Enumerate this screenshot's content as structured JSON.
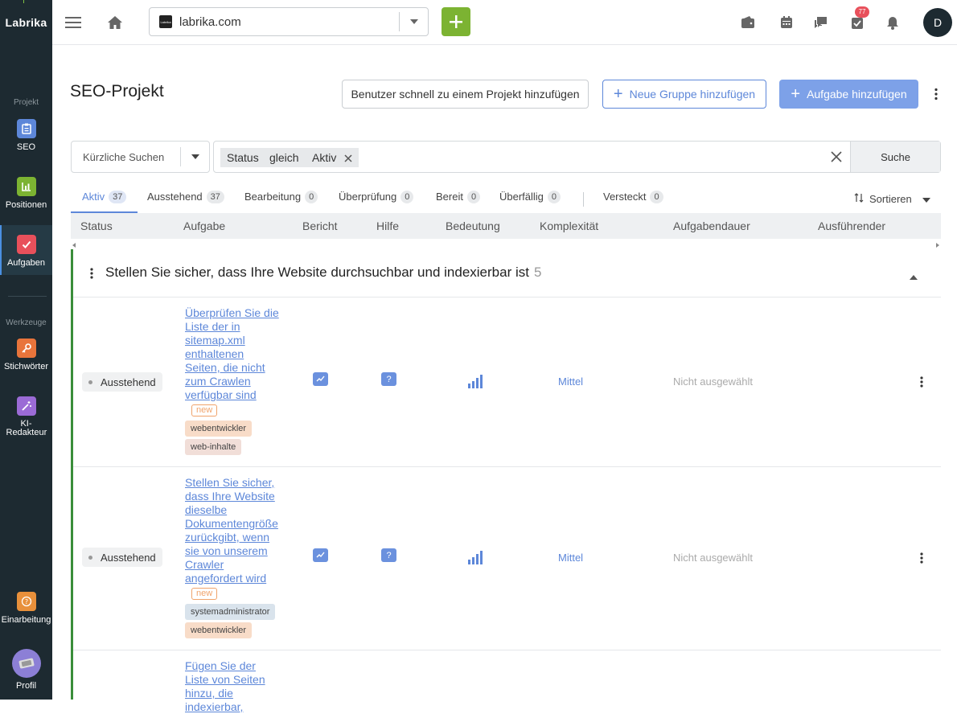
{
  "app": {
    "logo": "Labrika"
  },
  "sidebar": {
    "section_project": "Projekt",
    "section_tools": "Werkzeuge",
    "items": [
      {
        "label": "SEO",
        "color": "#5d87d9"
      },
      {
        "label": "Positionen",
        "color": "#7cb332"
      },
      {
        "label": "Aufgaben",
        "color": "#e8505b"
      },
      {
        "label": "Stichwörter",
        "color": "#e8743b"
      },
      {
        "label": "KI-Redakteur",
        "color": "#9b6bd6"
      },
      {
        "label": "Einarbeitung",
        "color": "#e8903b"
      },
      {
        "label": "Profil",
        "color": "#8c7fd6"
      }
    ]
  },
  "topbar": {
    "project_name": "labrika.com",
    "favicon_text": "Labrika",
    "tasks_badge": "77",
    "avatar_letter": "D"
  },
  "header": {
    "title": "SEO-Projekt",
    "btn_add_user": "Benutzer schnell zu einem Projekt hinzufügen",
    "btn_new_group": "Neue Gruppe hinzufügen",
    "btn_add_task": "Aufgabe hinzufügen"
  },
  "search": {
    "recent_label": "Kürzliche Suchen",
    "filter_field": "Status",
    "filter_op": "gleich",
    "filter_value": "Aktiv",
    "search_button": "Suche"
  },
  "tabs": [
    {
      "label": "Aktiv",
      "count": "37"
    },
    {
      "label": "Ausstehend",
      "count": "37"
    },
    {
      "label": "Bearbeitung",
      "count": "0"
    },
    {
      "label": "Überprüfung",
      "count": "0"
    },
    {
      "label": "Bereit",
      "count": "0"
    },
    {
      "label": "Überfällig",
      "count": "0"
    },
    {
      "label": "Versteckt",
      "count": "0"
    }
  ],
  "sort_label": "Sortieren",
  "columns": [
    "Status",
    "Aufgabe",
    "Bericht",
    "Hilfe",
    "Bedeutung",
    "Komplexität",
    "Aufgabendauer",
    "Ausführender"
  ],
  "group": {
    "title": "Stellen Sie sicher, dass Ihre Website durchsuchbar und indexierbar ist",
    "count": "5"
  },
  "rows": [
    {
      "status": "Ausstehend",
      "task": "Überprüfen Sie die Liste der in sitemap.xml enthaltenen Seiten, die nicht zum Crawlen verfügbar sind",
      "new_label": "new",
      "tags": [
        "webentwickler",
        "web-inhalte"
      ],
      "help": "?",
      "complexity": "Mittel",
      "duration": "Nicht ausgewählt"
    },
    {
      "status": "Ausstehend",
      "task": "Stellen Sie sicher, dass Ihre Website dieselbe Dokumentengröße zurückgibt, wenn sie von unserem Crawler angefordert wird",
      "new_label": "new",
      "tags": [
        "systemadministrator",
        "webentwickler"
      ],
      "help": "?",
      "complexity": "Mittel",
      "duration": "Nicht ausgewählt"
    },
    {
      "task": "Fügen Sie der Liste von Seiten hinzu, die indexierbar,"
    }
  ]
}
